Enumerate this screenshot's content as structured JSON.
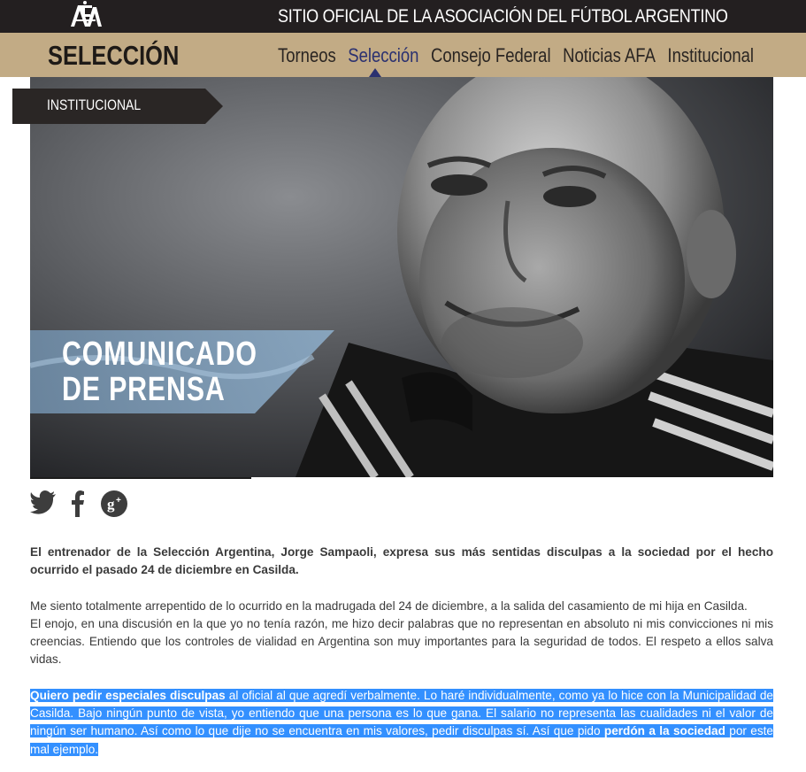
{
  "header": {
    "logo_alt": "AFA",
    "site_title": "SITIO OFICIAL DE LA ASOCIACIÓN DEL FÚTBOL ARGENTINO"
  },
  "nav": {
    "brand": "SELECCIÓN",
    "items": [
      {
        "label": "Torneos",
        "active": false
      },
      {
        "label": "Selección",
        "active": true
      },
      {
        "label": "Consejo Federal",
        "active": false
      },
      {
        "label": "Noticias AFA",
        "active": false
      },
      {
        "label": "Institucional",
        "active": false
      }
    ]
  },
  "hero": {
    "tag": "INSTITUCIONAL",
    "title_line1": "COMUNICADO",
    "title_line2": "DE PRENSA"
  },
  "social": {
    "icons": [
      "twitter-icon",
      "facebook-icon",
      "google-plus-icon"
    ]
  },
  "article": {
    "lead": "El entrenador de la Selección Argentina, Jorge Sampaoli, expresa sus más sentidas disculpas a la sociedad por el hecho ocurrido el pasado 24 de diciembre en Casilda.",
    "p1_line1": "Me siento totalmente arrepentido de lo ocurrido en la madrugada del 24 de diciembre, a la salida del casamiento de mi hija en Casilda.",
    "p1_line2": "El enojo, en una discusión en la que yo no tenía razón, me hizo decir palabras que no representan en absoluto ni mis convicciones ni mis creencias. Entiendo que los controles de vialidad en Argentina son muy importantes para la seguridad de todos. El respeto a ellos salva vidas.",
    "p2_bold1": "Quiero pedir especiales disculpas",
    "p2_text1": " al oficial al que agredí verbalmente. Lo haré individualmente, como ya lo hice con la Municipalidad de Casilda. Bajo ningún punto de vista, yo entiendo que una persona es lo que gana. El salario no representa las cualidades ni el valor de ningún ser humano. Así como lo que dije no se encuentra en mis valores, pedir disculpas sí. Así que pido ",
    "p2_bold2": "perdón a la sociedad",
    "p2_text2": " por este mal ejemplo."
  },
  "colors": {
    "topbar": "#231f20",
    "navbar": "#c2ab85",
    "nav_active": "#2b3170",
    "selection": "#3390ff"
  }
}
